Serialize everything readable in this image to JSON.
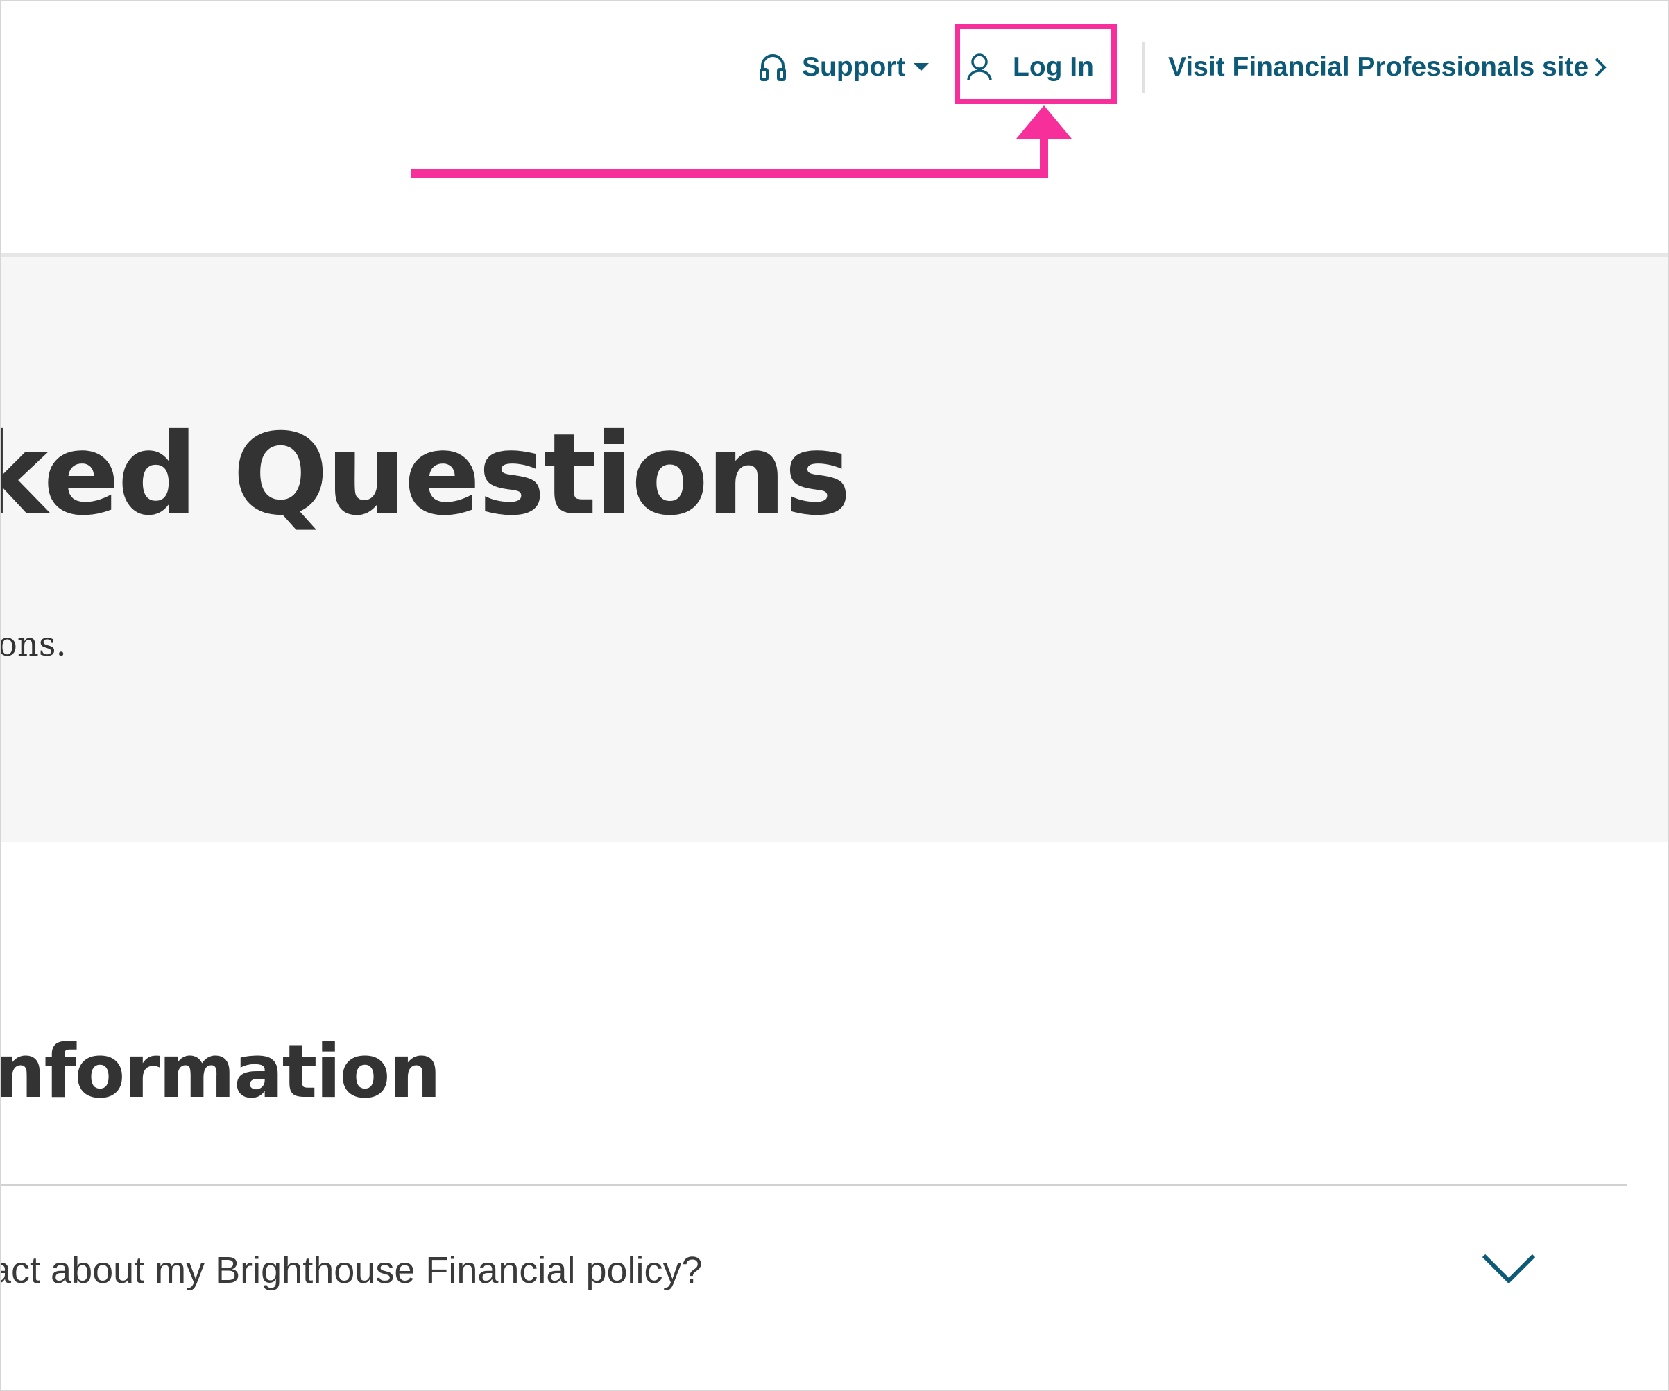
{
  "header": {
    "support_label": "Support",
    "login_label": "Log In",
    "visit_label": "Visit Financial Professionals site"
  },
  "hero": {
    "title": "ked Questions",
    "subtitle": "ons."
  },
  "section": {
    "title": "nformation"
  },
  "faq": {
    "question": "act about my Brighthouse Financial policy?"
  },
  "colors": {
    "link": "#0d5a78",
    "annotation": "#f72f9b",
    "hero_bg": "#f6f6f6",
    "heading": "#333333"
  },
  "icons": {
    "support": "headset-icon",
    "login": "user-icon",
    "visit": "chevron-right-icon",
    "faq": "chevron-down-icon"
  }
}
